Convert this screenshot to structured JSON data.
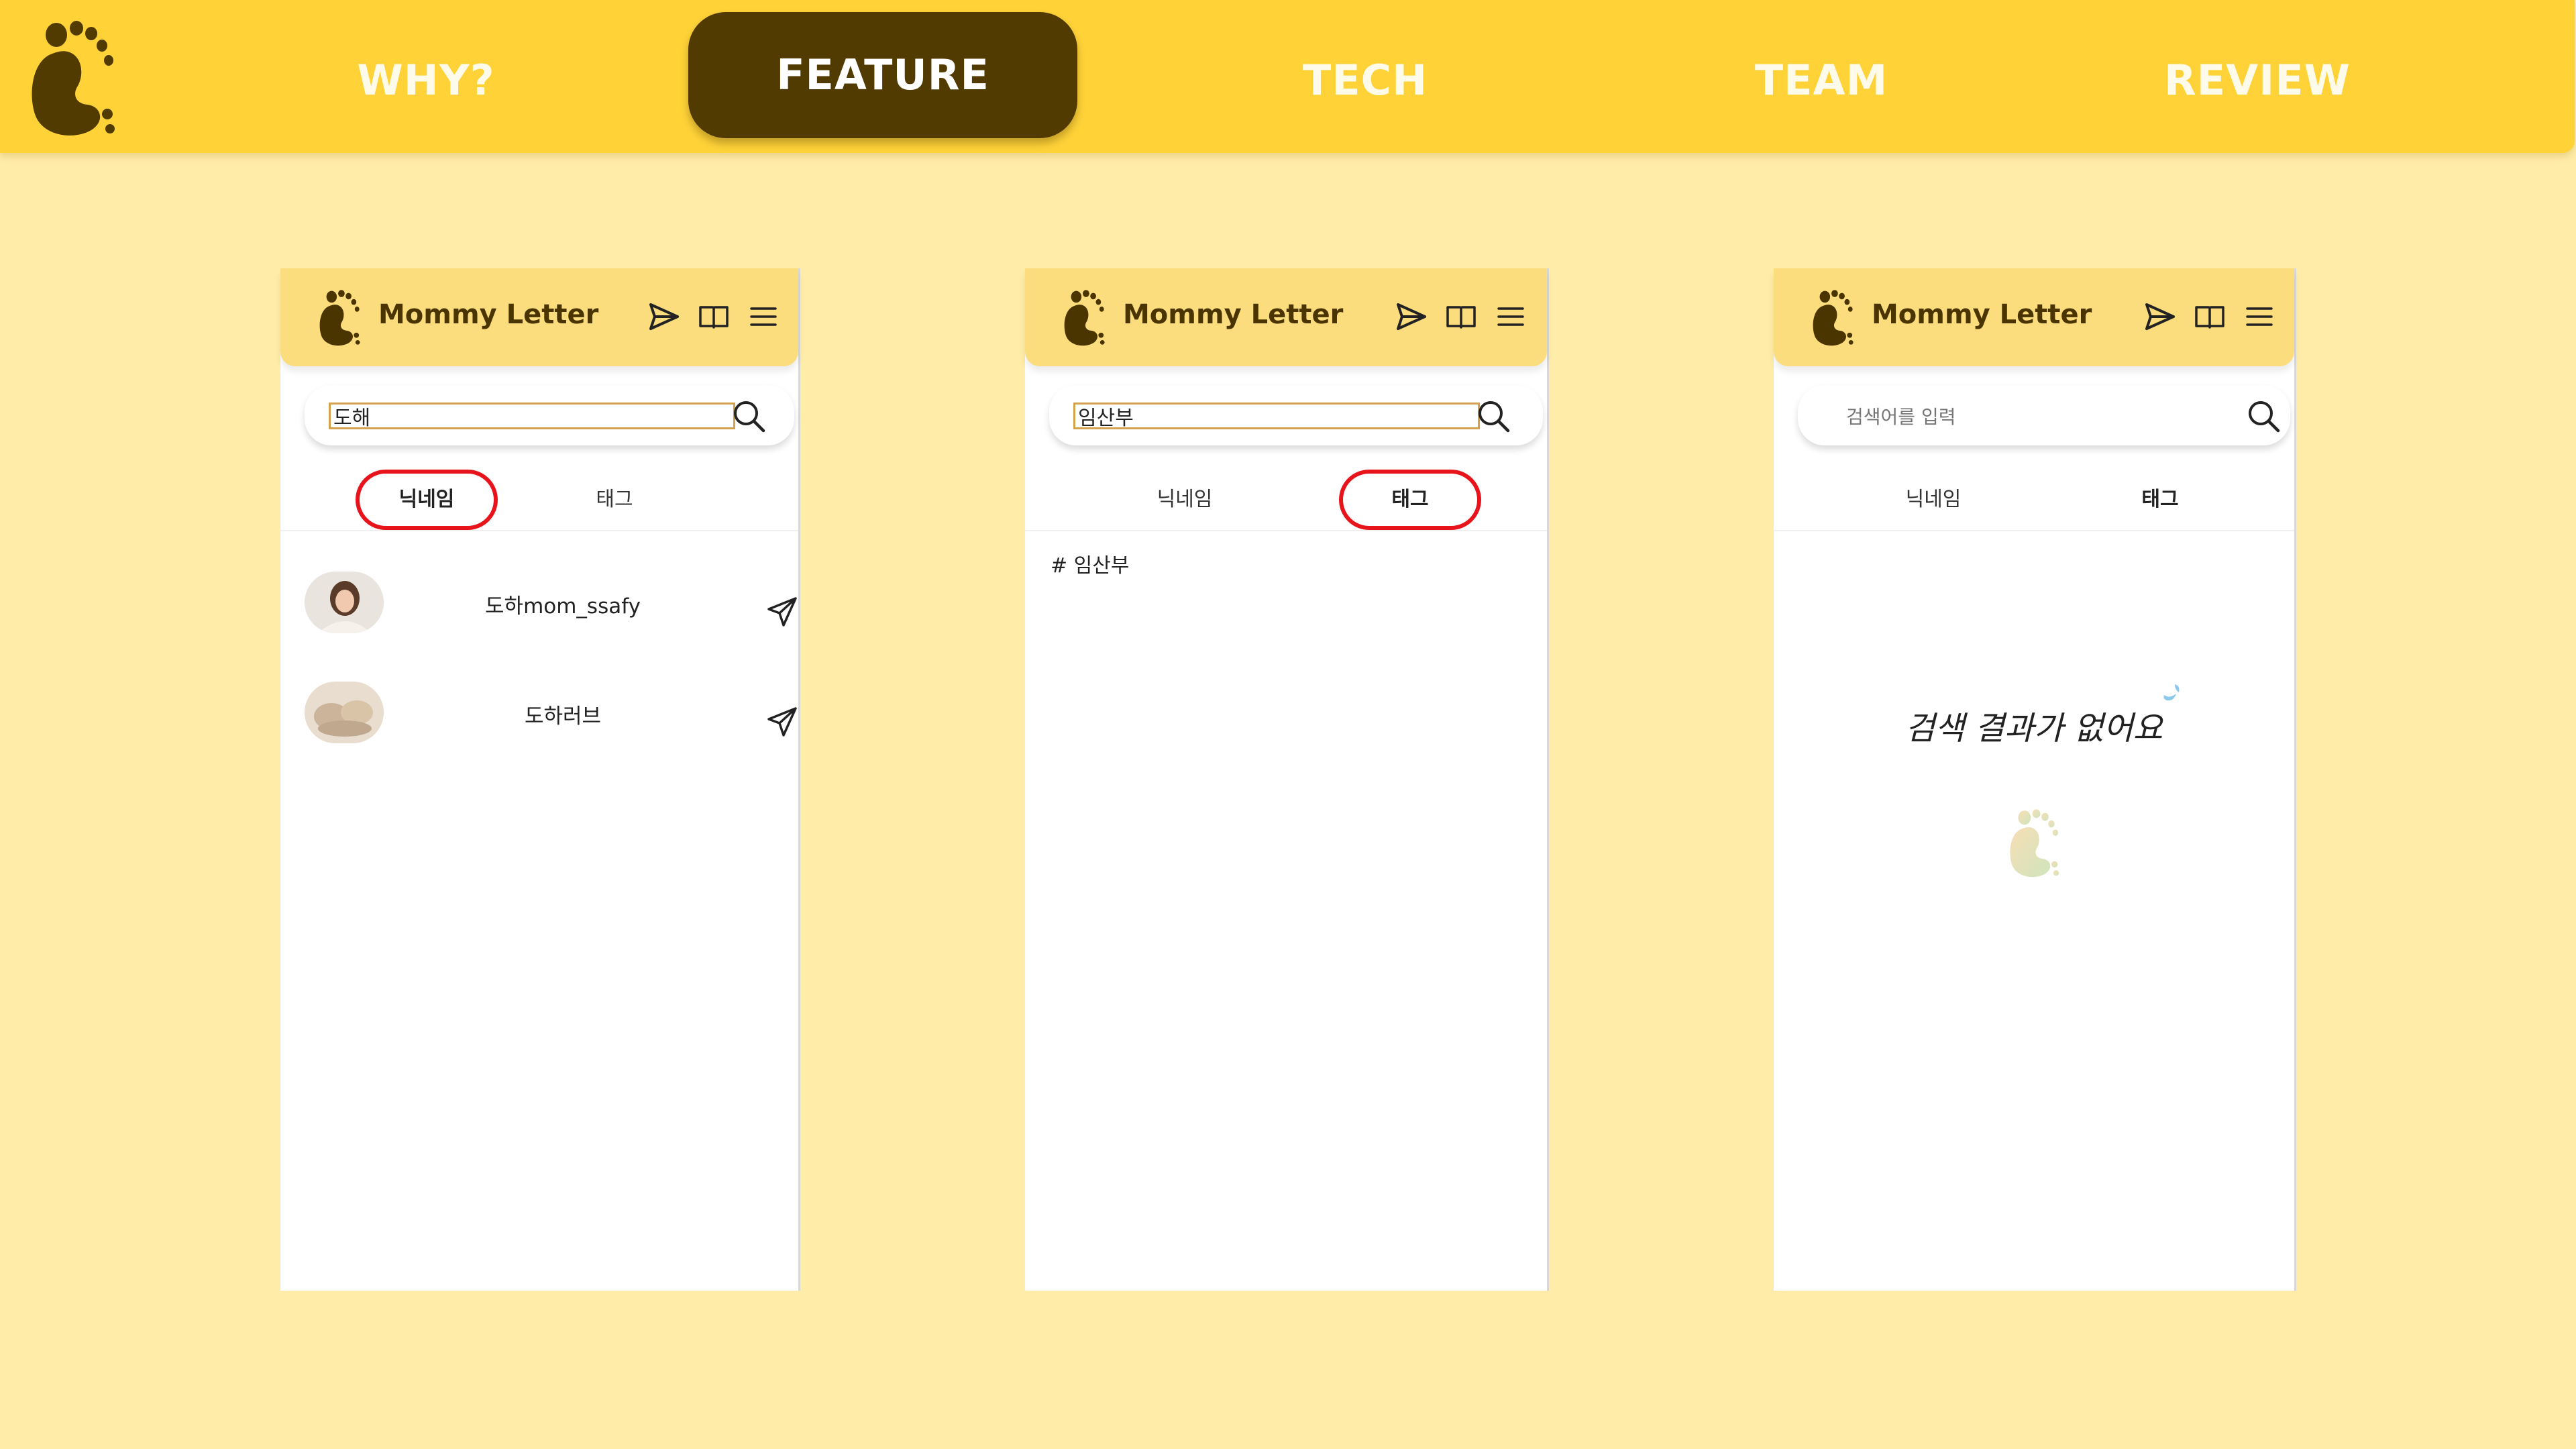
{
  "nav": {
    "items": [
      "WHY?",
      "FEATURE",
      "TECH",
      "TEAM",
      "REVIEW"
    ],
    "active": "FEATURE"
  },
  "colors": {
    "background": "#FFECA8",
    "topbar": "#FFD338",
    "active_nav": "#523B00",
    "phone_header": "#FBDD7D",
    "highlight_circle": "#E8141B",
    "brand_brown": "#4A3400"
  },
  "phones": [
    {
      "app_title": "Mommy Letter",
      "search_value": "도해",
      "tabs": [
        "닉네임",
        "태그"
      ],
      "active_tab": "닉네임",
      "users": [
        {
          "name": "도하mom_ssafy"
        },
        {
          "name": "도하러브"
        }
      ]
    },
    {
      "app_title": "Mommy Letter",
      "search_value": "임산부",
      "tabs": [
        "닉네임",
        "태그"
      ],
      "active_tab": "태그",
      "tag_result": "# 임산부"
    },
    {
      "app_title": "Mommy Letter",
      "search_placeholder": "검색어를 입력",
      "tabs": [
        "닉네임",
        "태그"
      ],
      "active_tab": "태그",
      "empty_message": "검색 결과가 없어요"
    }
  ]
}
